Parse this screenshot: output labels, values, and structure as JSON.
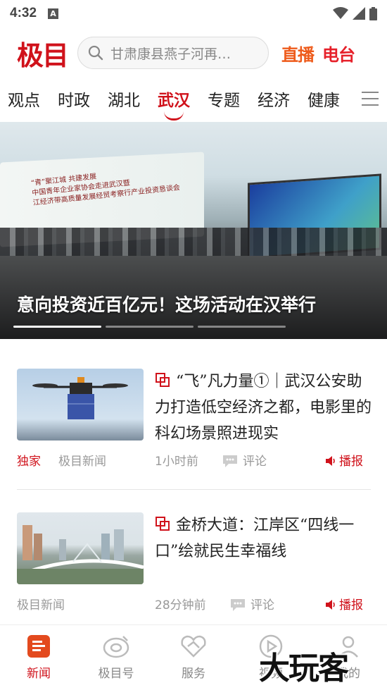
{
  "status_bar": {
    "time": "4:32",
    "notif_letter": "A"
  },
  "header": {
    "logo": "极目",
    "search_placeholder": "甘肃康县燕子河再…",
    "live_label": "直播",
    "radio_label": "电台"
  },
  "tabs": [
    "观点",
    "时政",
    "湖北",
    "武汉",
    "专题",
    "经济",
    "健康"
  ],
  "active_tab": "武汉",
  "banner": {
    "caption": "意向投资近百亿元！这场活动在汉举行",
    "wall_text": [
      "“青”聚江城 共建发展",
      "中国青年企业家协会走进武汉暨",
      "江经济带高质量发展经贸考察行产业投资恳谈会"
    ]
  },
  "news": [
    {
      "title": "“飞”凡力量①｜武汉公安助力打造低空经济之都，电影里的科幻场景照进现实",
      "tag": "独家",
      "source": "极目新闻",
      "time": "1小时前",
      "comment_label": "评论",
      "broadcast_label": "播报"
    },
    {
      "title": "金桥大道：江岸区“四线一口”绘就民生幸福线",
      "source": "极目新闻",
      "time": "28分钟前",
      "comment_label": "评论",
      "broadcast_label": "播报"
    }
  ],
  "bottom_nav": [
    {
      "label": "新闻",
      "icon": "news-icon",
      "active": true
    },
    {
      "label": "极目号",
      "icon": "jimu-hao-icon",
      "active": false
    },
    {
      "label": "服务",
      "icon": "service-icon",
      "active": false
    },
    {
      "label": "视频",
      "icon": "video-icon",
      "active": false
    },
    {
      "label": "我的",
      "icon": "profile-icon",
      "active": false
    }
  ],
  "watermark": "大玩客",
  "colors": {
    "brand": "#d0121b",
    "live": "#ee5b1b"
  }
}
